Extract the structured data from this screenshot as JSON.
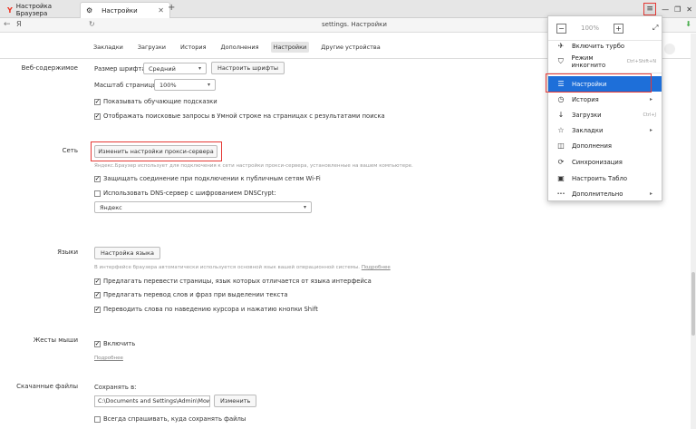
{
  "tabs": [
    {
      "title": "Настройка Браузера"
    },
    {
      "title": "Настройки"
    }
  ],
  "address": {
    "url": "settings. Настройки",
    "back_glyph": "←",
    "browser_letter": "Я"
  },
  "nav": [
    "Закладки",
    "Загрузки",
    "История",
    "Дополнения",
    "Настройки",
    "Другие устройства"
  ],
  "web": {
    "label": "Веб-содержимое",
    "font_size_label": "Размер шрифта:",
    "font_size_value": "Средний",
    "customize_fonts": "Настроить шрифты",
    "zoom_label": "Масштаб страницы:",
    "zoom_value": "100%",
    "check1": "Показывать обучающие подсказки",
    "check2": "Отображать поисковые запросы в Умной строке на страницах с результатами поиска"
  },
  "network": {
    "label": "Сеть",
    "proxy_button": "Изменить настройки прокси-сервера",
    "proxy_note": "Яндекс.Браузер использует для подключения к сети настройки прокси-сервера, установленные на вашем компьютере.",
    "check1": "Защищать соединение при подключении к публичным сетям Wi-Fi",
    "check2": "Использовать DNS-сервер с шифрованием DNSCrypt:",
    "dns_value": "Яндекс"
  },
  "languages": {
    "label": "Языки",
    "button": "Настройка языка",
    "note": "В интерфейсе браузера автоматически используется основной язык вашей операционной системы.",
    "more": "Подробнее",
    "check1": "Предлагать перевести страницы, язык которых отличается от языка интерфейса",
    "check2": "Предлагать перевод слов и фраз при выделении текста",
    "check3": "Переводить слова по наведению курсора и нажатию кнопки Shift"
  },
  "gestures": {
    "label": "Жесты мыши",
    "check1": "Включить",
    "more": "Подробнее"
  },
  "downloads": {
    "label": "Скачанные файлы",
    "save_to": "Сохранять в:",
    "path": "C:\\Documents and Settings\\Admin\\Мои",
    "change": "Изменить",
    "check1": "Всегда спрашивать, куда сохранять файлы"
  },
  "menu": {
    "zoom": "100%",
    "items": [
      {
        "label": "Включить турбо",
        "icon": "rocket-icon",
        "glyph": "✈"
      },
      {
        "label": "Режим инкогнито",
        "shortcut": "Ctrl+Shift+N",
        "icon": "incognito-icon",
        "glyph": "⛉"
      },
      {
        "label": "Настройки",
        "icon": "settings-sliders-icon",
        "glyph": "☰"
      },
      {
        "label": "История",
        "icon": "clock-icon",
        "glyph": "◷"
      },
      {
        "label": "Загрузки",
        "shortcut": "Ctrl+J",
        "icon": "download-icon",
        "glyph": "↓"
      },
      {
        "label": "Закладки",
        "icon": "star-icon",
        "glyph": "☆"
      },
      {
        "label": "Дополнения",
        "icon": "extensions-icon",
        "glyph": "◫"
      },
      {
        "label": "Синхронизация",
        "icon": "sync-icon",
        "glyph": "⟳"
      },
      {
        "label": "Настроить Табло",
        "icon": "board-icon",
        "glyph": "▣"
      },
      {
        "label": "Дополнительно",
        "icon": "more-icon",
        "glyph": "•••"
      }
    ]
  },
  "colors": {
    "accent": "#1e6fd9",
    "highlight_frame": "#e53935"
  }
}
